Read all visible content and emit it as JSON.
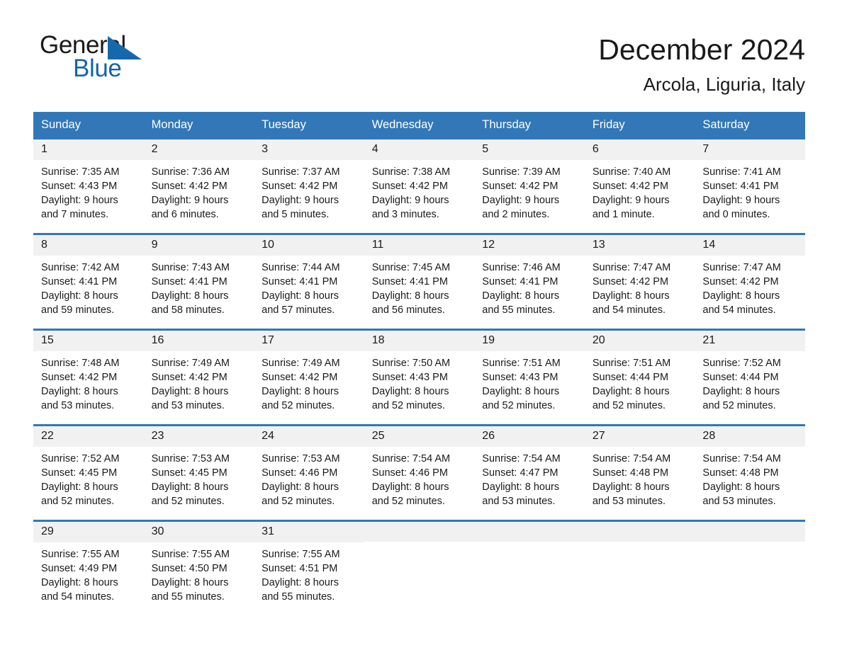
{
  "brand": {
    "name_part1": "General",
    "name_part2": "Blue",
    "accent_color": "#1664ab",
    "logo_icon": "triangle-flag-icon"
  },
  "header": {
    "title": "December 2024",
    "subtitle": "Arcola, Liguria, Italy"
  },
  "theme": {
    "header_bar_color": "#3278b8",
    "day_number_band_color": "#f1f1f1",
    "text_color": "#1a1a1a"
  },
  "calendar": {
    "weekdays": [
      "Sunday",
      "Monday",
      "Tuesday",
      "Wednesday",
      "Thursday",
      "Friday",
      "Saturday"
    ],
    "weeks": [
      [
        {
          "day": "1",
          "sunrise": "Sunrise: 7:35 AM",
          "sunset": "Sunset: 4:43 PM",
          "daylight_line1": "Daylight: 9 hours",
          "daylight_line2": "and 7 minutes."
        },
        {
          "day": "2",
          "sunrise": "Sunrise: 7:36 AM",
          "sunset": "Sunset: 4:42 PM",
          "daylight_line1": "Daylight: 9 hours",
          "daylight_line2": "and 6 minutes."
        },
        {
          "day": "3",
          "sunrise": "Sunrise: 7:37 AM",
          "sunset": "Sunset: 4:42 PM",
          "daylight_line1": "Daylight: 9 hours",
          "daylight_line2": "and 5 minutes."
        },
        {
          "day": "4",
          "sunrise": "Sunrise: 7:38 AM",
          "sunset": "Sunset: 4:42 PM",
          "daylight_line1": "Daylight: 9 hours",
          "daylight_line2": "and 3 minutes."
        },
        {
          "day": "5",
          "sunrise": "Sunrise: 7:39 AM",
          "sunset": "Sunset: 4:42 PM",
          "daylight_line1": "Daylight: 9 hours",
          "daylight_line2": "and 2 minutes."
        },
        {
          "day": "6",
          "sunrise": "Sunrise: 7:40 AM",
          "sunset": "Sunset: 4:42 PM",
          "daylight_line1": "Daylight: 9 hours",
          "daylight_line2": "and 1 minute."
        },
        {
          "day": "7",
          "sunrise": "Sunrise: 7:41 AM",
          "sunset": "Sunset: 4:41 PM",
          "daylight_line1": "Daylight: 9 hours",
          "daylight_line2": "and 0 minutes."
        }
      ],
      [
        {
          "day": "8",
          "sunrise": "Sunrise: 7:42 AM",
          "sunset": "Sunset: 4:41 PM",
          "daylight_line1": "Daylight: 8 hours",
          "daylight_line2": "and 59 minutes."
        },
        {
          "day": "9",
          "sunrise": "Sunrise: 7:43 AM",
          "sunset": "Sunset: 4:41 PM",
          "daylight_line1": "Daylight: 8 hours",
          "daylight_line2": "and 58 minutes."
        },
        {
          "day": "10",
          "sunrise": "Sunrise: 7:44 AM",
          "sunset": "Sunset: 4:41 PM",
          "daylight_line1": "Daylight: 8 hours",
          "daylight_line2": "and 57 minutes."
        },
        {
          "day": "11",
          "sunrise": "Sunrise: 7:45 AM",
          "sunset": "Sunset: 4:41 PM",
          "daylight_line1": "Daylight: 8 hours",
          "daylight_line2": "and 56 minutes."
        },
        {
          "day": "12",
          "sunrise": "Sunrise: 7:46 AM",
          "sunset": "Sunset: 4:41 PM",
          "daylight_line1": "Daylight: 8 hours",
          "daylight_line2": "and 55 minutes."
        },
        {
          "day": "13",
          "sunrise": "Sunrise: 7:47 AM",
          "sunset": "Sunset: 4:42 PM",
          "daylight_line1": "Daylight: 8 hours",
          "daylight_line2": "and 54 minutes."
        },
        {
          "day": "14",
          "sunrise": "Sunrise: 7:47 AM",
          "sunset": "Sunset: 4:42 PM",
          "daylight_line1": "Daylight: 8 hours",
          "daylight_line2": "and 54 minutes."
        }
      ],
      [
        {
          "day": "15",
          "sunrise": "Sunrise: 7:48 AM",
          "sunset": "Sunset: 4:42 PM",
          "daylight_line1": "Daylight: 8 hours",
          "daylight_line2": "and 53 minutes."
        },
        {
          "day": "16",
          "sunrise": "Sunrise: 7:49 AM",
          "sunset": "Sunset: 4:42 PM",
          "daylight_line1": "Daylight: 8 hours",
          "daylight_line2": "and 53 minutes."
        },
        {
          "day": "17",
          "sunrise": "Sunrise: 7:49 AM",
          "sunset": "Sunset: 4:42 PM",
          "daylight_line1": "Daylight: 8 hours",
          "daylight_line2": "and 52 minutes."
        },
        {
          "day": "18",
          "sunrise": "Sunrise: 7:50 AM",
          "sunset": "Sunset: 4:43 PM",
          "daylight_line1": "Daylight: 8 hours",
          "daylight_line2": "and 52 minutes."
        },
        {
          "day": "19",
          "sunrise": "Sunrise: 7:51 AM",
          "sunset": "Sunset: 4:43 PM",
          "daylight_line1": "Daylight: 8 hours",
          "daylight_line2": "and 52 minutes."
        },
        {
          "day": "20",
          "sunrise": "Sunrise: 7:51 AM",
          "sunset": "Sunset: 4:44 PM",
          "daylight_line1": "Daylight: 8 hours",
          "daylight_line2": "and 52 minutes."
        },
        {
          "day": "21",
          "sunrise": "Sunrise: 7:52 AM",
          "sunset": "Sunset: 4:44 PM",
          "daylight_line1": "Daylight: 8 hours",
          "daylight_line2": "and 52 minutes."
        }
      ],
      [
        {
          "day": "22",
          "sunrise": "Sunrise: 7:52 AM",
          "sunset": "Sunset: 4:45 PM",
          "daylight_line1": "Daylight: 8 hours",
          "daylight_line2": "and 52 minutes."
        },
        {
          "day": "23",
          "sunrise": "Sunrise: 7:53 AM",
          "sunset": "Sunset: 4:45 PM",
          "daylight_line1": "Daylight: 8 hours",
          "daylight_line2": "and 52 minutes."
        },
        {
          "day": "24",
          "sunrise": "Sunrise: 7:53 AM",
          "sunset": "Sunset: 4:46 PM",
          "daylight_line1": "Daylight: 8 hours",
          "daylight_line2": "and 52 minutes."
        },
        {
          "day": "25",
          "sunrise": "Sunrise: 7:54 AM",
          "sunset": "Sunset: 4:46 PM",
          "daylight_line1": "Daylight: 8 hours",
          "daylight_line2": "and 52 minutes."
        },
        {
          "day": "26",
          "sunrise": "Sunrise: 7:54 AM",
          "sunset": "Sunset: 4:47 PM",
          "daylight_line1": "Daylight: 8 hours",
          "daylight_line2": "and 53 minutes."
        },
        {
          "day": "27",
          "sunrise": "Sunrise: 7:54 AM",
          "sunset": "Sunset: 4:48 PM",
          "daylight_line1": "Daylight: 8 hours",
          "daylight_line2": "and 53 minutes."
        },
        {
          "day": "28",
          "sunrise": "Sunrise: 7:54 AM",
          "sunset": "Sunset: 4:48 PM",
          "daylight_line1": "Daylight: 8 hours",
          "daylight_line2": "and 53 minutes."
        }
      ],
      [
        {
          "day": "29",
          "sunrise": "Sunrise: 7:55 AM",
          "sunset": "Sunset: 4:49 PM",
          "daylight_line1": "Daylight: 8 hours",
          "daylight_line2": "and 54 minutes."
        },
        {
          "day": "30",
          "sunrise": "Sunrise: 7:55 AM",
          "sunset": "Sunset: 4:50 PM",
          "daylight_line1": "Daylight: 8 hours",
          "daylight_line2": "and 55 minutes."
        },
        {
          "day": "31",
          "sunrise": "Sunrise: 7:55 AM",
          "sunset": "Sunset: 4:51 PM",
          "daylight_line1": "Daylight: 8 hours",
          "daylight_line2": "and 55 minutes."
        },
        {
          "day": "",
          "sunrise": "",
          "sunset": "",
          "daylight_line1": "",
          "daylight_line2": ""
        },
        {
          "day": "",
          "sunrise": "",
          "sunset": "",
          "daylight_line1": "",
          "daylight_line2": ""
        },
        {
          "day": "",
          "sunrise": "",
          "sunset": "",
          "daylight_line1": "",
          "daylight_line2": ""
        },
        {
          "day": "",
          "sunrise": "",
          "sunset": "",
          "daylight_line1": "",
          "daylight_line2": ""
        }
      ]
    ]
  }
}
